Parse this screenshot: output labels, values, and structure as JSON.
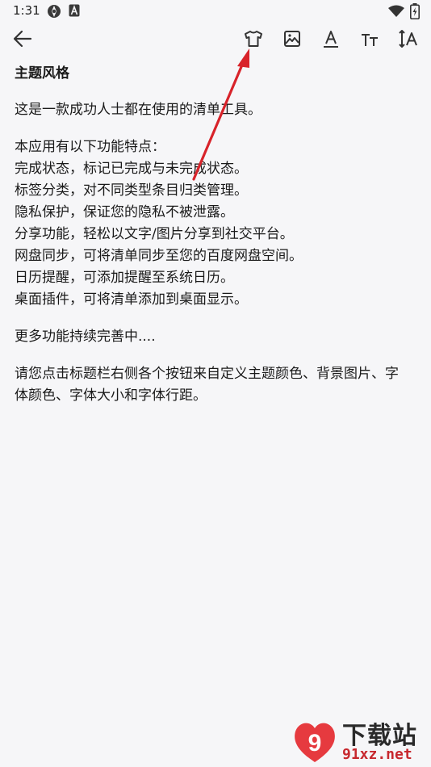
{
  "status_bar": {
    "time": "1:31",
    "icons": [
      "app-notification-icon",
      "a-notification-icon",
      "wifi-icon",
      "battery-icon"
    ]
  },
  "toolbar": {
    "buttons": [
      "back-arrow-icon",
      "theme-shirt-icon",
      "background-image-icon",
      "font-color-icon",
      "font-size-icon",
      "line-spacing-icon"
    ]
  },
  "content": {
    "title": "主题风格",
    "intro": "这是一款成功人士都在使用的清单工具。",
    "features_heading": "本应用有以下功能特点：",
    "features": [
      "完成状态，标记已完成与未完成状态。",
      "标签分类，对不同类型条目归类管理。",
      "隐私保护，保证您的隐私不被泄露。",
      "分享功能，轻松以文字/图片分享到社交平台。",
      "网盘同步，可将清单同步至您的百度网盘空间。",
      "日历提醒，可添加提醒至系统日历。",
      "桌面插件，可将清单添加到桌面显示。"
    ],
    "more": "更多功能持续完善中....",
    "instruction_line1": "请您点击标题栏右侧各个按钮来自定义主题颜色、背景图片、字",
    "instruction_line2": "体颜色、字体大小和字体行距。"
  },
  "annotation": {
    "color": "#d8232a"
  },
  "watermark": {
    "brand": "下载站",
    "badge": "9",
    "url": "91xz.net"
  },
  "colors": {
    "background": "#f6f6f8",
    "text": "#1a1a1a",
    "icon": "#333333",
    "accent_red": "#d8232a"
  }
}
